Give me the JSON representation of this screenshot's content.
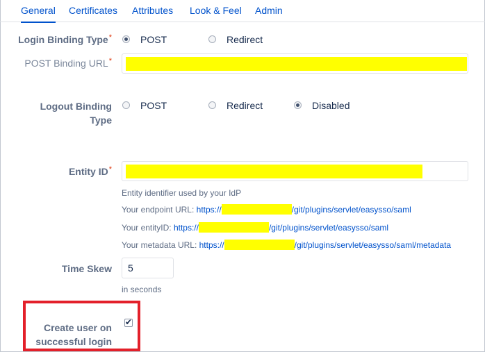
{
  "tabs": [
    {
      "label": "General",
      "active": true
    },
    {
      "label": "Certificates",
      "active": false
    },
    {
      "label": "Attributes",
      "active": false
    },
    {
      "label": "Look & Feel",
      "active": false
    },
    {
      "label": "Admin",
      "active": false
    }
  ],
  "login_binding": {
    "label": "Login Binding Type",
    "required": "*",
    "options": [
      {
        "label": "POST",
        "checked": true
      },
      {
        "label": "Redirect",
        "checked": false
      }
    ]
  },
  "post_binding_url": {
    "label": "POST Binding URL",
    "required": "*",
    "value": ""
  },
  "logout_binding": {
    "label": "Logout Binding Type",
    "options": [
      {
        "label": "POST",
        "checked": false
      },
      {
        "label": "Redirect",
        "checked": false
      },
      {
        "label": "Disabled",
        "checked": true
      }
    ]
  },
  "entity_id": {
    "label": "Entity ID",
    "required": "*",
    "value": "",
    "help": "Entity identifier used by your IdP",
    "endpoint": {
      "prefix": "Your endpoint URL: ",
      "link_start": "https://",
      "link_end": "/git/plugins/servlet/easysso/saml"
    },
    "entity": {
      "prefix": "Your entityID: ",
      "link_start": "https://",
      "link_end": "/git/plugins/servlet/easysso/saml"
    },
    "metadata": {
      "prefix": "Your metadata URL: ",
      "link_start": "https://",
      "link_end": "/git/plugins/servlet/easysso/saml/metadata"
    }
  },
  "time_skew": {
    "label": "Time Skew",
    "value": "5",
    "help": "in seconds"
  },
  "create_user": {
    "label": "Create user on successful login",
    "checked": true,
    "check_glyph": "✔"
  },
  "colors": {
    "accent": "#0052cc",
    "redacted": "#ffff00",
    "highlight_box": "#e3202a"
  }
}
